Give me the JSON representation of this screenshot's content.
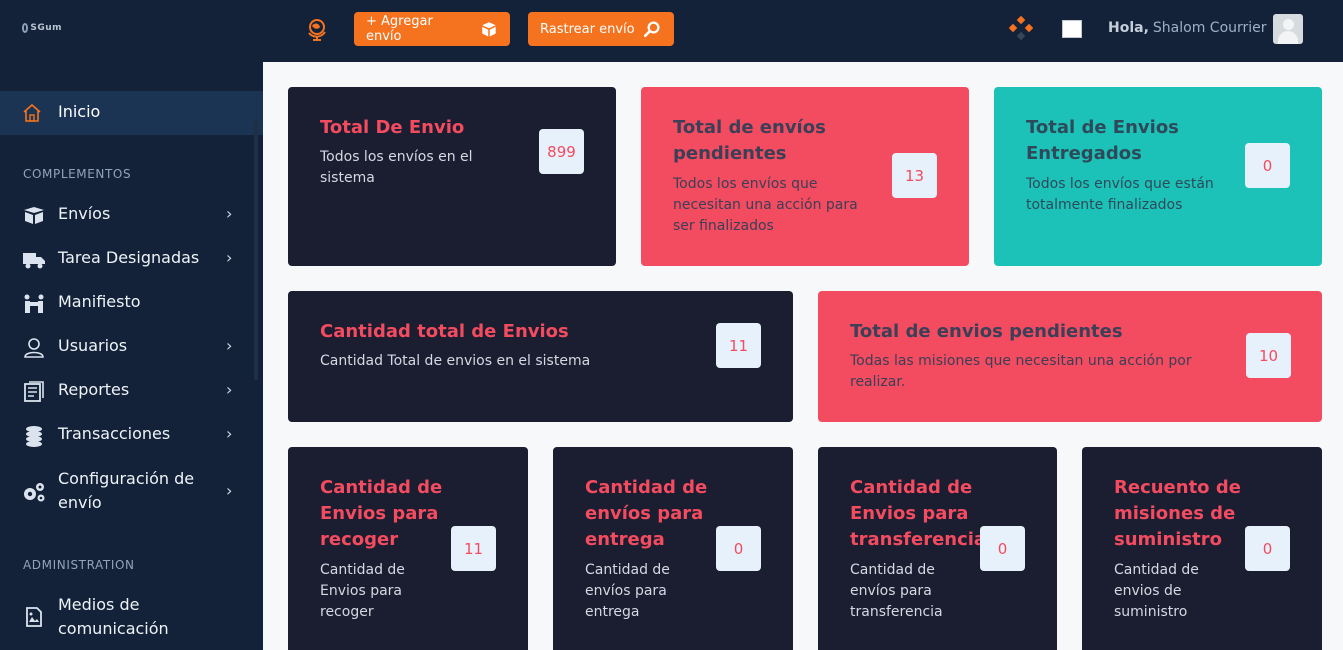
{
  "brand": {
    "logo_text": "SGum"
  },
  "sidebar": {
    "active": {
      "label": "Inicio",
      "icon": "home-icon"
    },
    "sections": {
      "complementos": "COMPLEMENTOS",
      "administration": "ADMINISTRATION"
    },
    "items": [
      {
        "label": "Envíos",
        "icon": "box-icon"
      },
      {
        "label": "Tarea Designadas",
        "icon": "truck-icon"
      },
      {
        "label": "Manifiesto",
        "icon": "people-icon"
      },
      {
        "label": "Usuarios",
        "icon": "user-icon"
      },
      {
        "label": "Reportes",
        "icon": "report-icon"
      },
      {
        "label": "Transacciones",
        "icon": "coins-icon"
      },
      {
        "label": "Configuración de envío",
        "icon": "gears-icon"
      },
      {
        "label": "Medios de comunicación",
        "icon": "media-icon"
      }
    ]
  },
  "topbar": {
    "add_label": "+ Agregar envío",
    "track_label": "Rastrear envío",
    "greeting": "Hola,",
    "user_name": "Shalom Courrier"
  },
  "cards": {
    "total": {
      "title": "Total De Envio",
      "desc": "Todos los envíos en el sistema",
      "value": "899"
    },
    "pending": {
      "title": "Total de envíos pendientes",
      "desc": "Todos los envíos que necesitan una acción para ser finalizados",
      "value": "13"
    },
    "delivered": {
      "title": "Total de Envios Entregados",
      "desc": "Todos los envíos que están totalmente finalizados",
      "value": "0"
    },
    "total_count": {
      "title": "Cantidad total de Envios",
      "desc": "Cantidad Total de envios en el sistema",
      "value": "11"
    },
    "pending_missions": {
      "title": "Total de envios pendientes",
      "desc": "Todas las misiones que necesitan una acción por realizar.",
      "value": "10"
    },
    "pickup": {
      "title": "Cantidad de Envios para recoger",
      "desc": "Cantidad de Envios para recoger",
      "value": "11"
    },
    "delivery": {
      "title": "Cantidad de envíos para entrega",
      "desc": "Cantidad de envíos para entrega",
      "value": "0"
    },
    "transfer": {
      "title": "Cantidad de Envios para transferencia",
      "desc": "Cantidad de envíos para transferencia",
      "value": "0"
    },
    "supply": {
      "title": "Recuento de misiones de suministro",
      "desc": "Cantidad de envios de suministro",
      "value": "0"
    }
  },
  "colors": {
    "sidebar": "#132238",
    "accent": "#f5731e",
    "dark_card": "#1b1d31",
    "pink_card": "#f34b5f",
    "teal_card": "#1cc2b8"
  }
}
